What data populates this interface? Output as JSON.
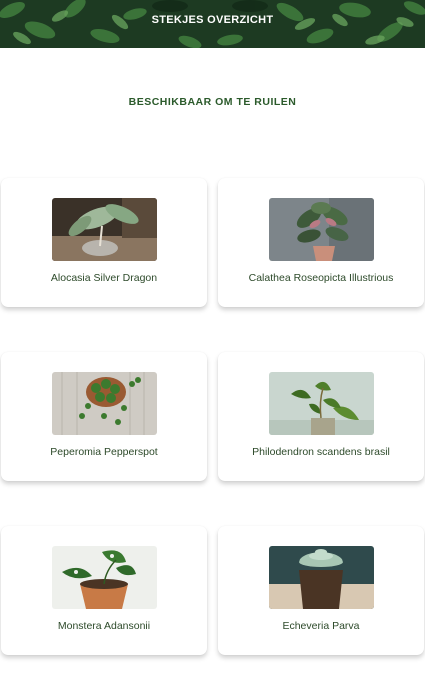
{
  "header": {
    "title": "STEKJES OVERZICHT"
  },
  "section": {
    "title": "BESCHIKBAAR OM TE RUILEN"
  },
  "plants": [
    {
      "name": "Alocasia Silver Dragon"
    },
    {
      "name": "Calathea Roseopicta Illustrious"
    },
    {
      "name": "Peperomia Pepperspot"
    },
    {
      "name": "Philodendron scandens brasil"
    },
    {
      "name": "Monstera Adansonii"
    },
    {
      "name": "Echeveria Parva"
    }
  ],
  "colors": {
    "header_bg": "#1f3a24",
    "section_title": "#2b5a2b",
    "card_text": "#2d4a2a"
  }
}
